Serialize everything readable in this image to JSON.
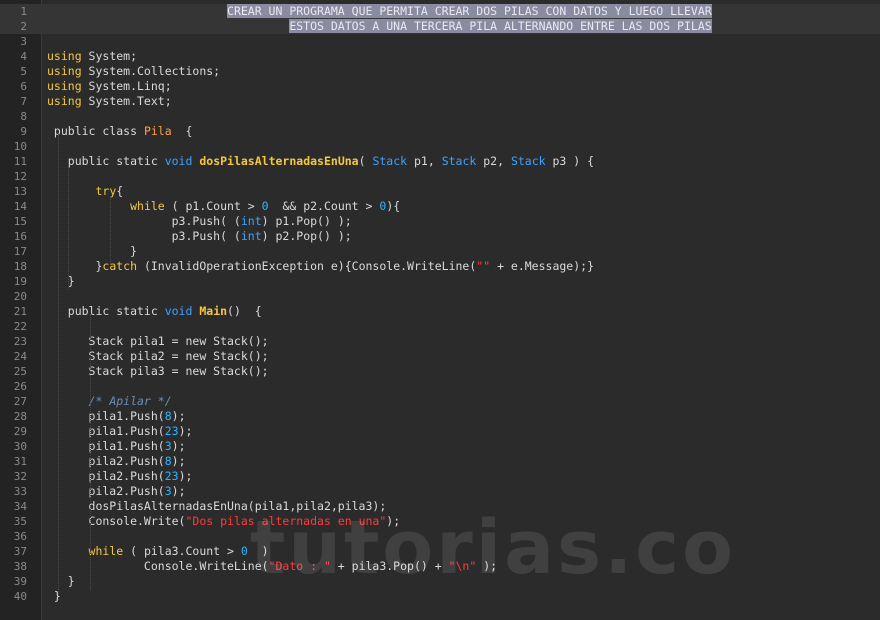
{
  "editor": {
    "line_numbers": [
      "1",
      "2",
      "3",
      "4",
      "5",
      "6",
      "7",
      "8",
      "9",
      "10",
      "11",
      "12",
      "13",
      "14",
      "15",
      "16",
      "17",
      "18",
      "19",
      "20",
      "21",
      "22",
      "23",
      "24",
      "25",
      "26",
      "27",
      "28",
      "29",
      "30",
      "31",
      "32",
      "33",
      "34",
      "35",
      "36",
      "37",
      "38",
      "39",
      "40"
    ],
    "lines": [
      [
        {
          "t": "                          ",
          "c": ""
        },
        {
          "t": "CREAR UN PROGRAMA QUE PERMITA CREAR DOS PILAS CON DATOS Y LUEGO LLEVAR",
          "c": "sel"
        }
      ],
      [
        {
          "t": "                                   ",
          "c": ""
        },
        {
          "t": "ESTOS DATOS A UNA TERCERA PILA ALTERNANDO ENTRE LAS DOS PILAS",
          "c": "sel"
        }
      ],
      [],
      [
        {
          "t": "using",
          "c": "kw"
        },
        {
          "t": " System;",
          "c": ""
        }
      ],
      [
        {
          "t": "using",
          "c": "kw"
        },
        {
          "t": " System.Collections;",
          "c": ""
        }
      ],
      [
        {
          "t": "using",
          "c": "kw"
        },
        {
          "t": " System.Linq;",
          "c": ""
        }
      ],
      [
        {
          "t": "using",
          "c": "kw"
        },
        {
          "t": " System.Text;",
          "c": ""
        }
      ],
      [],
      [
        {
          "t": " public class ",
          "c": ""
        },
        {
          "t": "Pila",
          "c": "cls"
        },
        {
          "t": "  {",
          "c": ""
        }
      ],
      [],
      [
        {
          "t": "   public static ",
          "c": ""
        },
        {
          "t": "void",
          "c": "ty"
        },
        {
          "t": " ",
          "c": ""
        },
        {
          "t": "dosPilasAlternadasEnUna",
          "c": "fn"
        },
        {
          "t": "( ",
          "c": ""
        },
        {
          "t": "Stack",
          "c": "ty"
        },
        {
          "t": " p1, ",
          "c": ""
        },
        {
          "t": "Stack",
          "c": "ty"
        },
        {
          "t": " p2, ",
          "c": ""
        },
        {
          "t": "Stack",
          "c": "ty"
        },
        {
          "t": " p3 ) {",
          "c": ""
        }
      ],
      [],
      [
        {
          "t": "       ",
          "c": ""
        },
        {
          "t": "try",
          "c": "kw"
        },
        {
          "t": "{",
          "c": ""
        }
      ],
      [
        {
          "t": "            ",
          "c": ""
        },
        {
          "t": "while",
          "c": "kw"
        },
        {
          "t": " ( p1.Count > ",
          "c": ""
        },
        {
          "t": "0",
          "c": "num"
        },
        {
          "t": "  && p2.Count > ",
          "c": ""
        },
        {
          "t": "0",
          "c": "num"
        },
        {
          "t": "){",
          "c": ""
        }
      ],
      [
        {
          "t": "                  p3.Push( (",
          "c": ""
        },
        {
          "t": "int",
          "c": "ty"
        },
        {
          "t": ") p1.Pop() );",
          "c": ""
        }
      ],
      [
        {
          "t": "                  p3.Push( (",
          "c": ""
        },
        {
          "t": "int",
          "c": "ty"
        },
        {
          "t": ") p2.Pop() );",
          "c": ""
        }
      ],
      [
        {
          "t": "            }",
          "c": ""
        }
      ],
      [
        {
          "t": "       }",
          "c": ""
        },
        {
          "t": "catch",
          "c": "kw"
        },
        {
          "t": " (InvalidOperationException e){Console.WriteLine(",
          "c": ""
        },
        {
          "t": "\"\"",
          "c": "str"
        },
        {
          "t": " + e.Message);}",
          "c": ""
        }
      ],
      [
        {
          "t": "   }",
          "c": ""
        }
      ],
      [],
      [
        {
          "t": "   public static ",
          "c": ""
        },
        {
          "t": "void",
          "c": "ty"
        },
        {
          "t": " ",
          "c": ""
        },
        {
          "t": "Main",
          "c": "fn"
        },
        {
          "t": "()  {",
          "c": ""
        }
      ],
      [],
      [
        {
          "t": "      Stack pila1 = new Stack();",
          "c": ""
        }
      ],
      [
        {
          "t": "      Stack pila2 = new Stack();",
          "c": ""
        }
      ],
      [
        {
          "t": "      Stack pila3 = new Stack();",
          "c": ""
        }
      ],
      [],
      [
        {
          "t": "      ",
          "c": ""
        },
        {
          "t": "/* Apilar */",
          "c": "cm"
        }
      ],
      [
        {
          "t": "      pila1.Push(",
          "c": ""
        },
        {
          "t": "8",
          "c": "num"
        },
        {
          "t": ");",
          "c": ""
        }
      ],
      [
        {
          "t": "      pila1.Push(",
          "c": ""
        },
        {
          "t": "23",
          "c": "num"
        },
        {
          "t": ");",
          "c": ""
        }
      ],
      [
        {
          "t": "      pila1.Push(",
          "c": ""
        },
        {
          "t": "3",
          "c": "num"
        },
        {
          "t": ");",
          "c": ""
        }
      ],
      [
        {
          "t": "      pila2.Push(",
          "c": ""
        },
        {
          "t": "8",
          "c": "num"
        },
        {
          "t": ");",
          "c": ""
        }
      ],
      [
        {
          "t": "      pila2.Push(",
          "c": ""
        },
        {
          "t": "23",
          "c": "num"
        },
        {
          "t": ");",
          "c": ""
        }
      ],
      [
        {
          "t": "      pila2.Push(",
          "c": ""
        },
        {
          "t": "3",
          "c": "num"
        },
        {
          "t": ");",
          "c": ""
        }
      ],
      [
        {
          "t": "      dosPilasAlternadasEnUna(pila1,pila2,pila3);",
          "c": ""
        }
      ],
      [
        {
          "t": "      Console.Write(",
          "c": ""
        },
        {
          "t": "\"Dos pilas alternadas en una\"",
          "c": "str"
        },
        {
          "t": ");",
          "c": ""
        }
      ],
      [],
      [
        {
          "t": "      ",
          "c": ""
        },
        {
          "t": "while",
          "c": "kw"
        },
        {
          "t": " ( pila3.Count > ",
          "c": ""
        },
        {
          "t": "0",
          "c": "num"
        },
        {
          "t": "  )",
          "c": ""
        }
      ],
      [
        {
          "t": "              Console.WriteLine(",
          "c": ""
        },
        {
          "t": "\"Dato : \"",
          "c": "str"
        },
        {
          "t": " + pila3.Pop() + ",
          "c": ""
        },
        {
          "t": "\"\\n\"",
          "c": "str"
        },
        {
          "t": " );",
          "c": ""
        }
      ],
      [
        {
          "t": "   }",
          "c": ""
        }
      ],
      [
        {
          "t": " }",
          "c": ""
        }
      ]
    ],
    "highlighted_lines": [
      1,
      2
    ]
  },
  "watermark": {
    "text": "tutorias.co"
  }
}
